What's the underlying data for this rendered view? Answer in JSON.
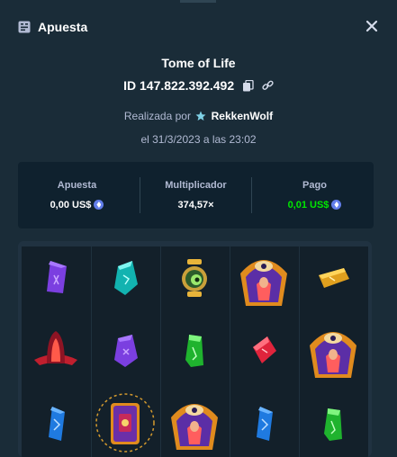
{
  "header": {
    "title": "Apuesta",
    "icon": "bet-ticket-icon",
    "close_icon": "close-icon"
  },
  "game": {
    "name": "Tome of Life",
    "id": "ID 147.822.392.492",
    "placed_prefix": "Realizada por",
    "user": "RekkenWolf",
    "date": "el 31/3/2023 a las 23:02"
  },
  "stats": {
    "bet_label": "Apuesta",
    "bet_value": "0,00 US$",
    "multiplier_label": "Multiplicador",
    "multiplier_value": "374,57×",
    "payout_label": "Pago",
    "payout_value": "0,01 US$"
  },
  "colors": {
    "background": "#1a2c38",
    "panel": "#0f212e",
    "payout": "#00e701",
    "coin": "#627eea"
  },
  "board": {
    "columns": [
      [
        "purple-rune-icon",
        "red-hooded-figure-icon",
        "blue-rune-icon"
      ],
      [
        "teal-rune-icon",
        "purple-rune-icon",
        "tome-book-icon"
      ],
      [
        "gold-lantern-icon",
        "green-rune-icon",
        "goddess-eye-icon"
      ],
      [
        "goddess-eye-icon",
        "red-rune-icon",
        "blue-rune-icon"
      ],
      [
        "yellow-rune-icon",
        "goddess-eye-icon",
        "green-rune-icon"
      ]
    ]
  }
}
